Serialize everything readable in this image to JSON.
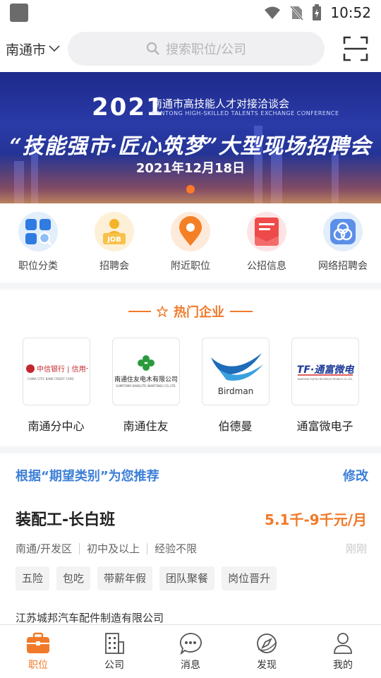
{
  "status": {
    "time": "10:52"
  },
  "header": {
    "city": "南通市",
    "search_placeholder": "搜索职位/公司"
  },
  "banner": {
    "year": "2021",
    "line1": "南通市高技能人才对接洽谈会",
    "line2": "NANTONG HIGH-SKILLED TALENTS EXCHANGE CONFERENCE",
    "title": "“技能强市·匠心筑梦”大型现场招聘会",
    "date": "2021年12月18日"
  },
  "categories": [
    {
      "label": "职位分类",
      "icon": "grid-search-icon"
    },
    {
      "label": "招聘会",
      "icon": "job-fair-icon"
    },
    {
      "label": "附近职位",
      "icon": "location-pin-icon"
    },
    {
      "label": "公招信息",
      "icon": "document-folder-icon"
    },
    {
      "label": "网络招聘会",
      "icon": "network-rings-icon"
    }
  ],
  "hot_companies": {
    "title": "热门企业",
    "items": [
      {
        "name": "南通分中心",
        "logo_text": "中信银行 | 信用卡",
        "logo_sub": "CHINA CITIC BANK  CREDIT CARD"
      },
      {
        "name": "南通住友",
        "logo_text": "南通住友电木有限公司",
        "logo_sub": "SUMITOMO BAKELITE (NANTONG) CO.,LTD."
      },
      {
        "name": "伯德曼",
        "logo_text": "Birdman"
      },
      {
        "name": "通富微电子",
        "logo_text": "TF·通富微电",
        "logo_sub": "NANTONG FUJITSU MICROELECTRONICS CO.,LTD."
      }
    ]
  },
  "recommend": {
    "title": "根据“期望类别”为您推荐",
    "modify": "修改",
    "job": {
      "title": "装配工-长白班",
      "salary": "5.1千-9千元/月",
      "location": "南通/开发区",
      "education": "初中及以上",
      "experience": "经验不限",
      "time": "刚刚",
      "tags": [
        "五险",
        "包吃",
        "带薪年假",
        "团队聚餐",
        "岗位晋升"
      ],
      "company": "江苏城邦汽车配件制造有限公司"
    }
  },
  "tabs": [
    {
      "label": "职位",
      "icon": "briefcase-icon",
      "active": true
    },
    {
      "label": "公司",
      "icon": "building-icon"
    },
    {
      "label": "消息",
      "icon": "chat-bubble-icon"
    },
    {
      "label": "发现",
      "icon": "compass-icon"
    },
    {
      "label": "我的",
      "icon": "user-icon"
    }
  ],
  "colors": {
    "accent": "#f07a2a",
    "link": "#3d7fd8"
  }
}
